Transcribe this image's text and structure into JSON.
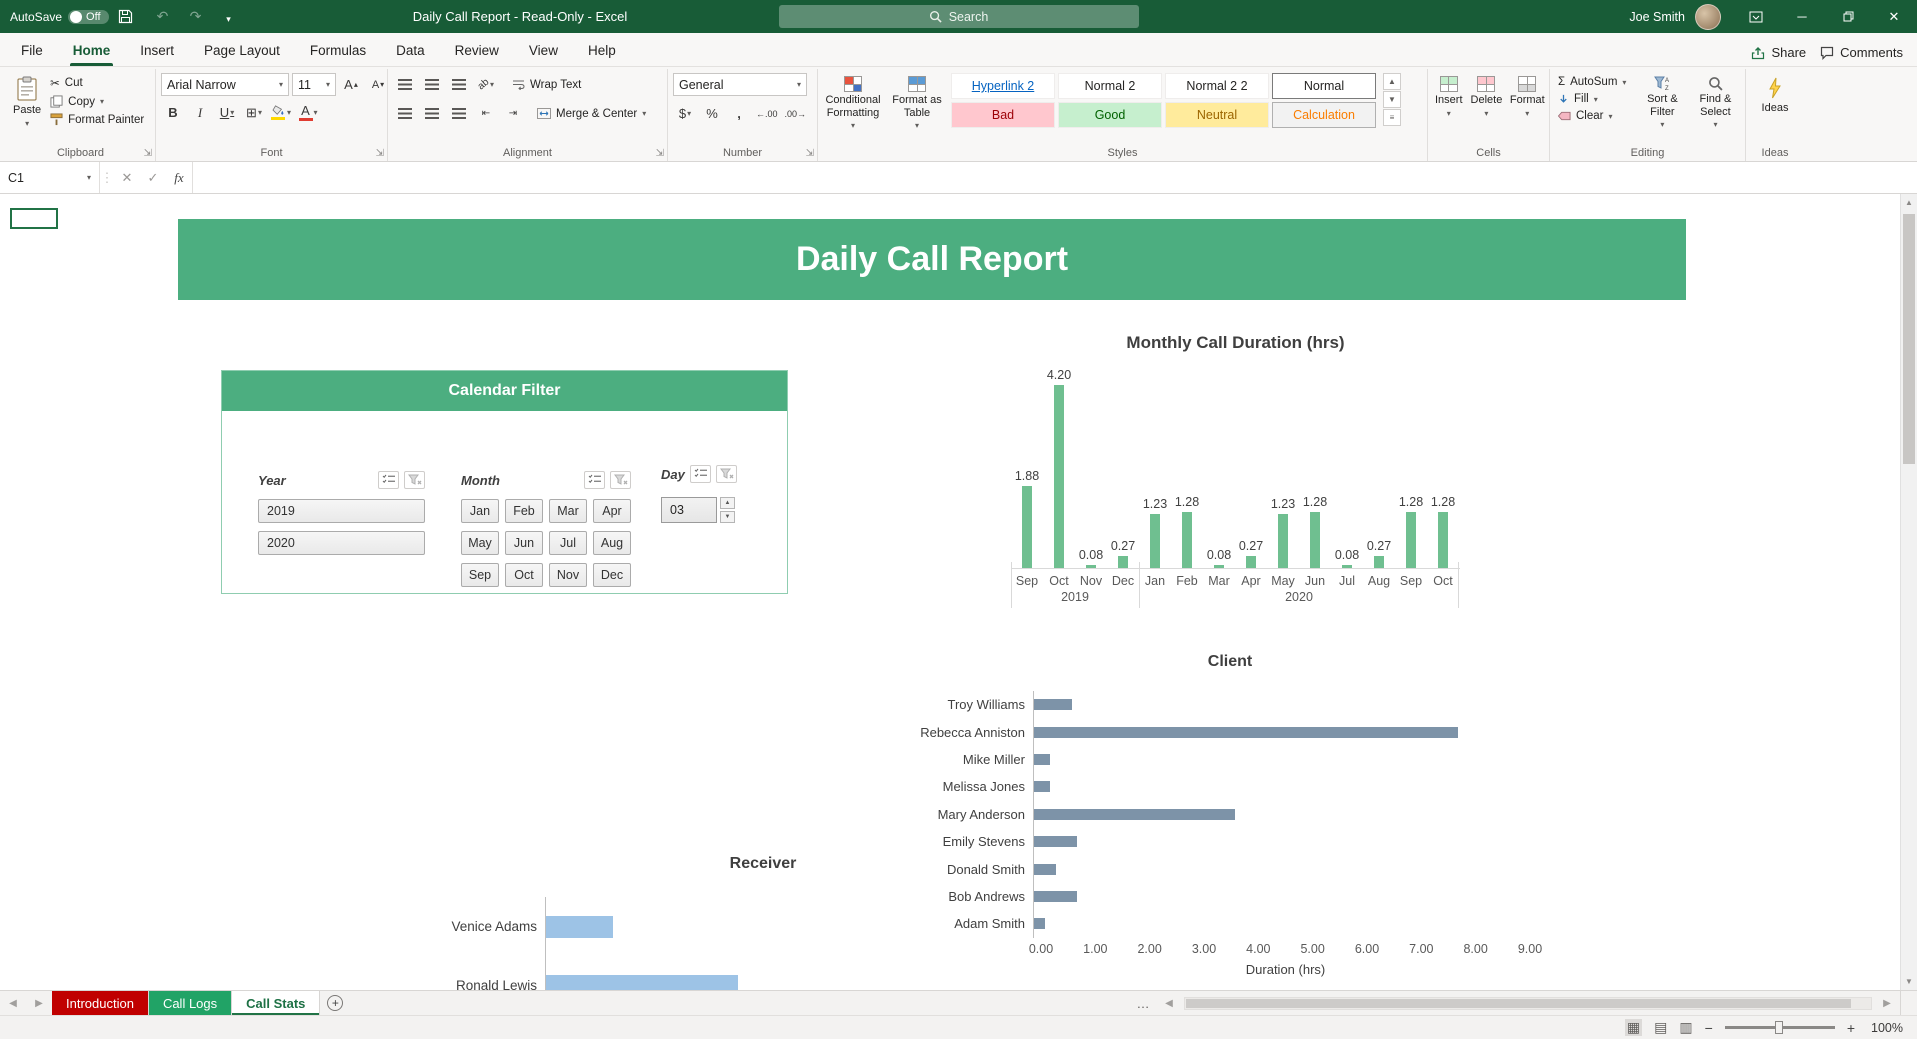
{
  "title_bar": {
    "autosave_label": "AutoSave",
    "autosave_state": "Off",
    "app_title": "Daily Call Report  -  Read-Only  -  Excel",
    "search_placeholder": "Search",
    "user_name": "Joe Smith"
  },
  "ribbon_tabs": {
    "items": [
      "File",
      "Home",
      "Insert",
      "Page Layout",
      "Formulas",
      "Data",
      "Review",
      "View",
      "Help"
    ],
    "active": "Home",
    "share": "Share",
    "comments": "Comments"
  },
  "ribbon": {
    "clipboard": {
      "label": "Clipboard",
      "paste": "Paste",
      "cut": "Cut",
      "copy": "Copy",
      "format_painter": "Format Painter"
    },
    "font": {
      "label": "Font",
      "name": "Arial Narrow",
      "size": "11"
    },
    "alignment": {
      "label": "Alignment",
      "wrap": "Wrap Text",
      "merge": "Merge & Center"
    },
    "number": {
      "label": "Number",
      "format": "General"
    },
    "styles": {
      "label": "Styles",
      "conditional": "Conditional Formatting",
      "format_table": "Format as Table",
      "gallery": [
        "Hyperlink 2",
        "Normal 2",
        "Normal 2 2",
        "Normal",
        "Bad",
        "Good",
        "Neutral",
        "Calculation"
      ]
    },
    "cells": {
      "label": "Cells",
      "insert": "Insert",
      "delete": "Delete",
      "format": "Format"
    },
    "editing": {
      "label": "Editing",
      "autosum": "AutoSum",
      "fill": "Fill",
      "clear": "Clear",
      "sort": "Sort & Filter",
      "find": "Find & Select"
    },
    "ideas": {
      "label": "Ideas",
      "button": "Ideas"
    }
  },
  "formula_bar": {
    "name_box": "C1",
    "value": ""
  },
  "worksheet": {
    "banner": "Daily Call Report",
    "calendar_filter": {
      "title": "Calendar Filter",
      "year_label": "Year",
      "years": [
        "2019",
        "2020"
      ],
      "month_label": "Month",
      "months": [
        "Jan",
        "Feb",
        "Mar",
        "Apr",
        "May",
        "Jun",
        "Jul",
        "Aug",
        "Sep",
        "Oct",
        "Nov",
        "Dec"
      ],
      "day_label": "Day",
      "day_value": "03"
    }
  },
  "chart_data": [
    {
      "type": "bar",
      "title": "Monthly Call Duration (hrs)",
      "categories": [
        "Sep",
        "Oct",
        "Nov",
        "Dec",
        "Jan",
        "Feb",
        "Mar",
        "Apr",
        "May",
        "Jun",
        "Jul",
        "Aug",
        "Sep",
        "Oct"
      ],
      "year_groups": [
        {
          "label": "2019",
          "count": 4
        },
        {
          "label": "2020",
          "count": 10
        }
      ],
      "values": [
        1.88,
        4.2,
        0.08,
        0.27,
        1.23,
        1.28,
        0.08,
        0.27,
        1.23,
        1.28,
        0.08,
        0.27,
        1.28,
        1.28
      ],
      "data_labels": [
        "1.88",
        "4.20",
        "0.08",
        "0.27",
        "1.23",
        "1.28",
        "0.08",
        "0.27",
        "1.23",
        "1.28",
        "0.08",
        "0.27",
        "1.28",
        "1.28"
      ],
      "bar_color": "#6fbf90",
      "ylim": [
        0,
        4.2
      ],
      "grid": false,
      "legend": "none"
    },
    {
      "type": "bar-horizontal",
      "title": "Client",
      "categories": [
        "Troy Williams",
        "Rebecca Anniston",
        "Mike Miller",
        "Melissa Jones",
        "Mary Anderson",
        "Emily Stevens",
        "Donald Smith",
        "Bob Andrews",
        "Adam Smith"
      ],
      "values": [
        0.7,
        7.8,
        0.3,
        0.3,
        3.7,
        0.8,
        0.4,
        0.8,
        0.2
      ],
      "xlabel": "Duration (hrs)",
      "xlim": [
        0,
        9
      ],
      "ticks": [
        "0.00",
        "1.00",
        "2.00",
        "3.00",
        "4.00",
        "5.00",
        "6.00",
        "7.00",
        "8.00",
        "9.00"
      ],
      "bar_color": "#7d93a8",
      "grid": false,
      "legend": "none"
    },
    {
      "type": "bar-horizontal",
      "title": "Receiver",
      "categories": [
        "Venice Adams",
        "Ronald Lewis"
      ],
      "values": [
        0.9,
        2.6
      ],
      "bar_color": "#9dc3e6",
      "grid": false,
      "legend": "none"
    }
  ],
  "sheet_tabs": {
    "items": [
      {
        "name": "Introduction",
        "style": "red"
      },
      {
        "name": "Call Logs",
        "style": "green"
      },
      {
        "name": "Call Stats",
        "style": "active"
      }
    ]
  },
  "status_bar": {
    "zoom": "100%"
  }
}
